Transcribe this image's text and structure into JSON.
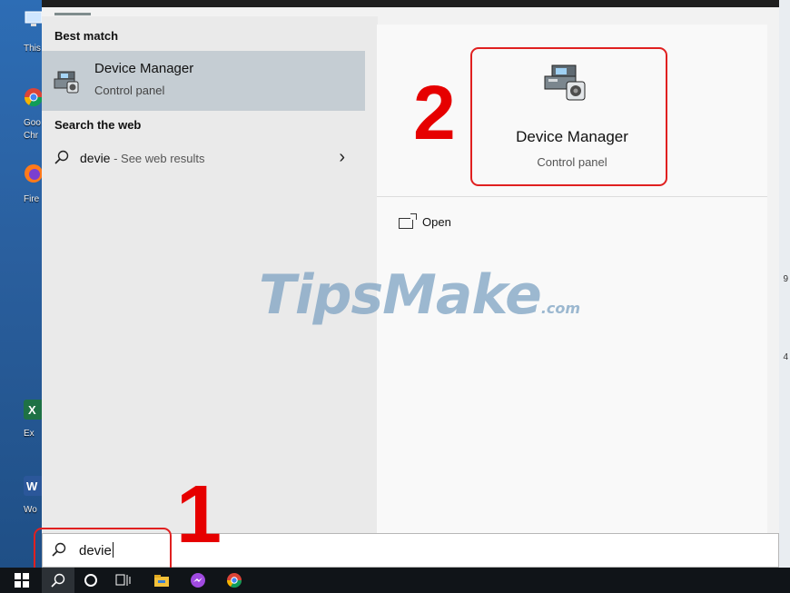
{
  "desktop": {
    "icons": [
      {
        "name": "this-pc",
        "label": "This"
      },
      {
        "name": "google-chrome",
        "label": "Goo"
      },
      {
        "name": "google-chrome-2",
        "label": "Chr"
      },
      {
        "name": "firefox",
        "label": "Fire"
      },
      {
        "name": "excel",
        "label": "Ex"
      },
      {
        "name": "word",
        "label": "Wo"
      }
    ],
    "right_edge": [
      "9",
      "4"
    ]
  },
  "start_menu": {
    "best_match_title": "Best match",
    "best_match": {
      "name": "Device Manager",
      "subtitle": "Control panel",
      "icon": "device-manager-icon"
    },
    "web_title": "Search the web",
    "web_result": {
      "query": "devie",
      "hint": " - See web results",
      "arrow": "›"
    },
    "preview": {
      "name": "Device Manager",
      "subtitle": "Control panel"
    },
    "actions": [
      {
        "label": "Open",
        "icon": "open-icon"
      }
    ]
  },
  "search": {
    "value": "devie"
  },
  "watermark": {
    "text": "TipsMake",
    "domain": ".com"
  },
  "annotations": {
    "step1": "1",
    "step2": "2",
    "color": "#e00000"
  },
  "taskbar": {
    "items": [
      "start-icon",
      "search-icon",
      "cortana-icon",
      "task-view-icon",
      "file-explorer-icon",
      "messenger-icon",
      "chrome-icon"
    ]
  }
}
